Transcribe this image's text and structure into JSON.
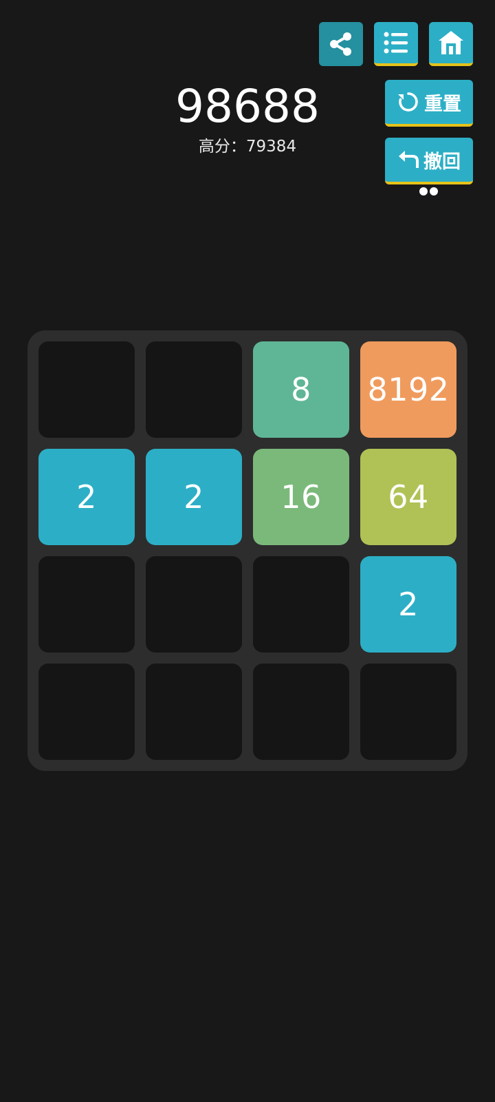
{
  "header": {
    "score": "98688",
    "best_score_text": "高分：79384",
    "buttons": [
      {
        "name": "share-button",
        "icon": "share-icon"
      },
      {
        "name": "list-button",
        "icon": "list-icon"
      },
      {
        "name": "home-button",
        "icon": "home-icon"
      }
    ],
    "reset_label": "重置",
    "undo_label": "撤回",
    "undo_remaining": 2
  },
  "colors": {
    "background": "#181818",
    "board": "#2d2d2d",
    "empty_cell": "#151515",
    "button": "#2cafc6",
    "button_accent": "#e6c21a",
    "tile_2": "#2cafc6",
    "tile_8": "#5fb696",
    "tile_16": "#7bb97b",
    "tile_64": "#b0c255",
    "tile_8192": "#f09b5e"
  },
  "board": {
    "rows": [
      [
        {
          "value": ""
        },
        {
          "value": ""
        },
        {
          "value": "8",
          "color": "#5fb696"
        },
        {
          "value": "8192",
          "color": "#f09b5e"
        }
      ],
      [
        {
          "value": "2",
          "color": "#2cafc6"
        },
        {
          "value": "2",
          "color": "#2cafc6"
        },
        {
          "value": "16",
          "color": "#7bb97b"
        },
        {
          "value": "64",
          "color": "#b0c255"
        }
      ],
      [
        {
          "value": ""
        },
        {
          "value": ""
        },
        {
          "value": ""
        },
        {
          "value": "2",
          "color": "#2cafc6"
        }
      ],
      [
        {
          "value": ""
        },
        {
          "value": ""
        },
        {
          "value": ""
        },
        {
          "value": ""
        }
      ]
    ]
  }
}
